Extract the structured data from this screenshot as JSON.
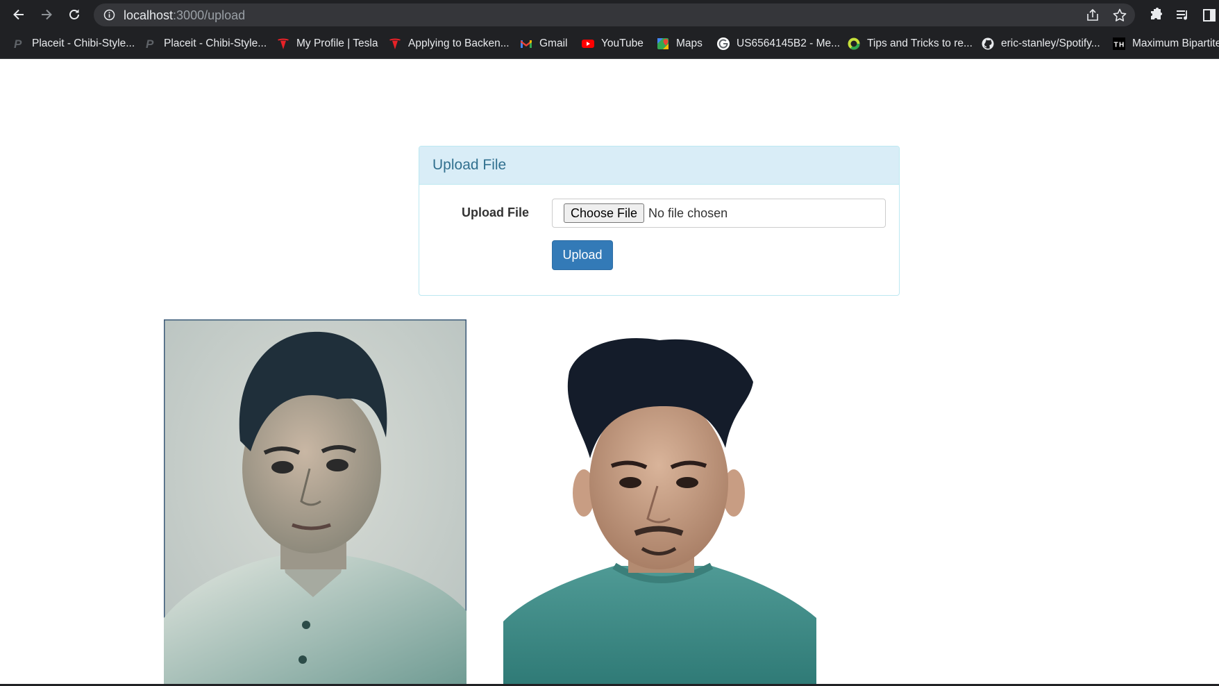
{
  "browser": {
    "url_host": "localhost",
    "url_rest": ":3000/upload",
    "nav_icons": [
      "back-arrow-icon",
      "forward-arrow-icon",
      "reload-icon"
    ],
    "omnibox_icons": [
      "info-icon",
      "share-icon",
      "star-icon"
    ],
    "toolbar_icons": [
      "extensions-puzzle-icon",
      "reading-list-icon",
      "side-panel-icon"
    ],
    "bookmarks": [
      {
        "label": "Placeit - Chibi-Style...",
        "icon": "placeit-icon"
      },
      {
        "label": "Placeit - Chibi-Style...",
        "icon": "placeit-icon"
      },
      {
        "label": "My Profile | Tesla",
        "icon": "tesla-icon"
      },
      {
        "label": "Applying to Backen...",
        "icon": "tesla-icon"
      },
      {
        "label": "Gmail",
        "icon": "gmail-icon"
      },
      {
        "label": "YouTube",
        "icon": "youtube-icon"
      },
      {
        "label": "Maps",
        "icon": "maps-icon"
      },
      {
        "label": "US6564145B2 - Me...",
        "icon": "google-icon"
      },
      {
        "label": "Tips and Tricks to re...",
        "icon": "ring-icon"
      },
      {
        "label": "eric-stanley/Spotify...",
        "icon": "github-icon"
      },
      {
        "label": "Maximum Bipartite",
        "icon": "th-icon"
      }
    ]
  },
  "upload_panel": {
    "heading": "Upload File",
    "field_label": "Upload File",
    "choose_button": "Choose File",
    "file_status": "No file chosen",
    "submit_button": "Upload"
  },
  "photos": [
    {
      "name": "uploaded-photo-1",
      "background": "#c9d2cf"
    },
    {
      "name": "uploaded-photo-2",
      "background": "#ffffff"
    }
  ]
}
